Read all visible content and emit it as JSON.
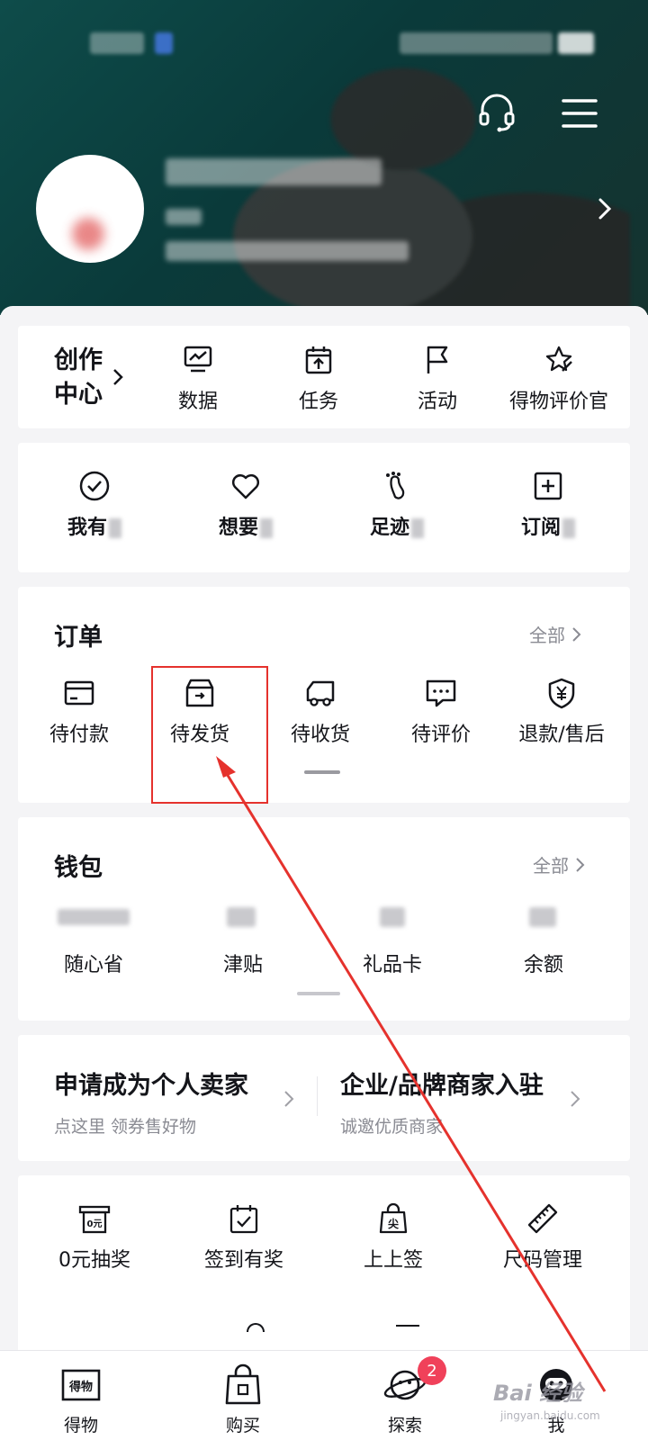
{
  "header": {
    "status_blurred": true,
    "profile_blurred": true
  },
  "creator": {
    "entry_label_line1": "创作",
    "entry_label_line2": "中心",
    "items": [
      {
        "label": "数据",
        "icon": "chart-monitor-icon"
      },
      {
        "label": "任务",
        "icon": "calendar-upload-icon"
      },
      {
        "label": "活动",
        "icon": "flag-icon"
      },
      {
        "label": "得物评价官",
        "icon": "star-pen-icon"
      }
    ]
  },
  "collections": {
    "items": [
      {
        "label": "我有",
        "icon": "check-circle-icon"
      },
      {
        "label": "想要",
        "icon": "heart-icon"
      },
      {
        "label": "足迹",
        "icon": "footprint-icon"
      },
      {
        "label": "订阅",
        "icon": "plus-square-icon"
      }
    ]
  },
  "orders": {
    "title": "订单",
    "more_label": "全部",
    "items": [
      {
        "label": "待付款",
        "icon": "card-icon"
      },
      {
        "label": "待发货",
        "icon": "box-icon"
      },
      {
        "label": "待收货",
        "icon": "truck-icon"
      },
      {
        "label": "待评价",
        "icon": "comment-icon"
      },
      {
        "label": "退款/售后",
        "icon": "shield-yen-icon"
      }
    ]
  },
  "wallet": {
    "title": "钱包",
    "more_label": "全部",
    "items": [
      {
        "label": "随心省"
      },
      {
        "label": "津贴"
      },
      {
        "label": "礼品卡"
      },
      {
        "label": "余额"
      }
    ]
  },
  "seller": {
    "personal_title": "申请成为个人卖家",
    "personal_sub": "点这里 领券售好物",
    "business_title": "企业/品牌商家入驻",
    "business_sub": "诚邀优质商家"
  },
  "tools": {
    "items": [
      {
        "label": "0元抽奖",
        "icon": "lottery-icon",
        "icon_text": "0元"
      },
      {
        "label": "签到有奖",
        "icon": "calendar-check-icon"
      },
      {
        "label": "上上签",
        "icon": "bag-sign-icon",
        "icon_text": "尖"
      },
      {
        "label": "尺码管理",
        "icon": "ruler-icon"
      }
    ]
  },
  "bottom_nav": {
    "items": [
      {
        "label": "得物",
        "icon": "dewu-logo-icon",
        "icon_text": "得物"
      },
      {
        "label": "购买",
        "icon": "shopping-bag-icon"
      },
      {
        "label": "探索",
        "icon": "planet-icon",
        "badge": "2"
      },
      {
        "label": "我",
        "icon": "avatar-icon"
      }
    ]
  },
  "watermark": {
    "text": "Bai 经验",
    "sub": "jingyan.baidu.com"
  },
  "colors": {
    "header_bg": "#0e4c4a",
    "annotation": "#e5322d",
    "badge": "#f0415a"
  }
}
